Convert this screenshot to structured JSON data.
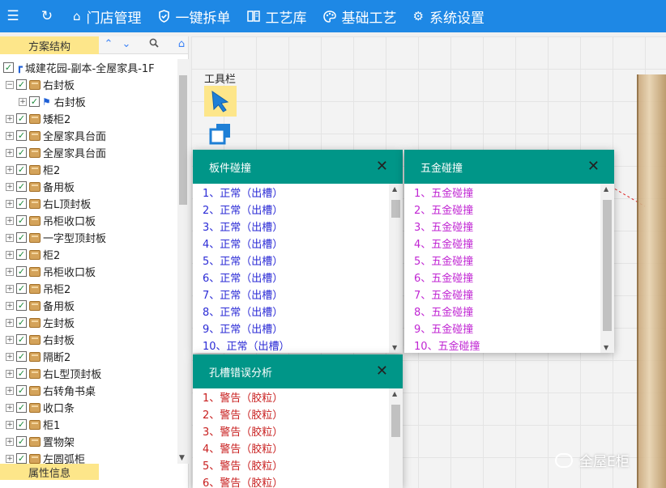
{
  "topbar": {
    "nav": [
      {
        "icon": "home-icon",
        "label": "门店管理"
      },
      {
        "icon": "shield-check-icon",
        "label": "一键拆单"
      },
      {
        "icon": "book-icon",
        "label": "工艺库"
      },
      {
        "icon": "palette-icon",
        "label": "基础工艺"
      },
      {
        "icon": "gear-icon",
        "label": "系统设置"
      }
    ]
  },
  "left_panel": {
    "title": "方案结构",
    "footer": "属性信息",
    "tree": {
      "root": "城建花园-副本-全屋家具-1F",
      "items": [
        {
          "label": "右封板",
          "expanded": true
        },
        {
          "label": "右封板",
          "child": true
        },
        {
          "label": "矮柜2"
        },
        {
          "label": "全屋家具台面"
        },
        {
          "label": "全屋家具台面"
        },
        {
          "label": "柜2"
        },
        {
          "label": "备用板"
        },
        {
          "label": "右L顶封板"
        },
        {
          "label": "吊柜收口板"
        },
        {
          "label": "一字型顶封板"
        },
        {
          "label": "柜2"
        },
        {
          "label": "吊柜收口板"
        },
        {
          "label": "吊柜2"
        },
        {
          "label": "备用板"
        },
        {
          "label": "左封板"
        },
        {
          "label": "右封板"
        },
        {
          "label": "隔断2"
        },
        {
          "label": "右L型顶封板"
        },
        {
          "label": "右转角书桌"
        },
        {
          "label": "收口条"
        },
        {
          "label": "柜1"
        },
        {
          "label": "置物架"
        },
        {
          "label": "左圆弧柜"
        }
      ]
    }
  },
  "canvas": {
    "toolbar_label": "工具栏"
  },
  "dialogs": {
    "board_collision": {
      "title": "板件碰撞",
      "color": "#2b2bd6",
      "items": [
        "1、正常（出槽）",
        "2、正常（出槽）",
        "3、正常（出槽）",
        "4、正常（出槽）",
        "5、正常（出槽）",
        "6、正常（出槽）",
        "7、正常（出槽）",
        "8、正常（出槽）",
        "9、正常（出槽）",
        "10、正常（出槽）"
      ]
    },
    "hardware_collision": {
      "title": "五金碰撞",
      "color": "#c026d3",
      "items": [
        "1、五金碰撞",
        "2、五金碰撞",
        "3、五金碰撞",
        "4、五金碰撞",
        "5、五金碰撞",
        "6、五金碰撞",
        "7、五金碰撞",
        "8、五金碰撞",
        "9、五金碰撞",
        "10、五金碰撞"
      ]
    },
    "slot_error": {
      "title": "孔槽错误分析",
      "color": "#c81e1e",
      "items": [
        "1、警告（胶粒）",
        "2、警告（胶粒）",
        "3、警告（胶粒）",
        "4、警告（胶粒）",
        "5、警告（胶粒）",
        "6、警告（胶粒）"
      ]
    }
  },
  "watermark": "全屋E柜",
  "colors": {
    "topbar": "#1e88e5",
    "dialog_header": "#009688",
    "highlight": "#fde68a"
  }
}
